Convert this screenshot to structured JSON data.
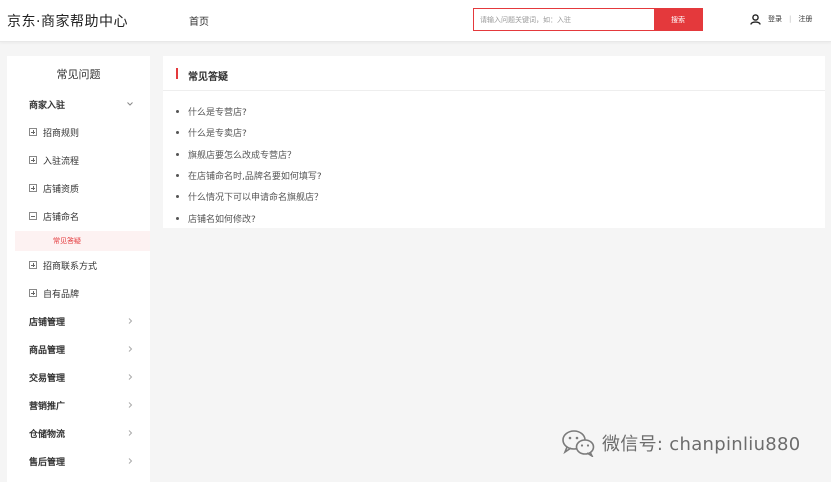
{
  "header": {
    "logo": "京东·商家帮助中心",
    "nav_home": "首页",
    "search": {
      "placeholder": "请输入问题关键词，如：入驻",
      "button": "搜索"
    },
    "login": "登录",
    "register": "注册"
  },
  "sidebar": {
    "title": "常见问题",
    "categories": [
      {
        "label": "商家入驻",
        "expanded": true
      },
      {
        "label": "店铺管理"
      },
      {
        "label": "商品管理"
      },
      {
        "label": "交易管理"
      },
      {
        "label": "营销推广"
      },
      {
        "label": "仓储物流"
      },
      {
        "label": "售后管理"
      }
    ],
    "sub_items": [
      {
        "label": "招商规则",
        "state": "collapsed"
      },
      {
        "label": "入驻流程",
        "state": "collapsed"
      },
      {
        "label": "店铺资质",
        "state": "collapsed"
      },
      {
        "label": "店铺命名",
        "state": "expanded"
      },
      {
        "label": "招商联系方式",
        "state": "collapsed"
      },
      {
        "label": "自有品牌",
        "state": "collapsed"
      }
    ],
    "active_item": "常见答疑"
  },
  "content": {
    "title": "常见答疑",
    "faqs": [
      "什么是专营店?",
      "什么是专卖店?",
      "旗舰店要怎么改成专营店？",
      "在店铺命名时,品牌名要如何填写?",
      "什么情况下可以申请命名旗舰店？",
      "店铺名如何修改?"
    ]
  },
  "watermark": {
    "text": "微信号: chanpinliu880"
  },
  "colors": {
    "accent": "#e4393c",
    "active_bg": "#fdf2f2"
  }
}
